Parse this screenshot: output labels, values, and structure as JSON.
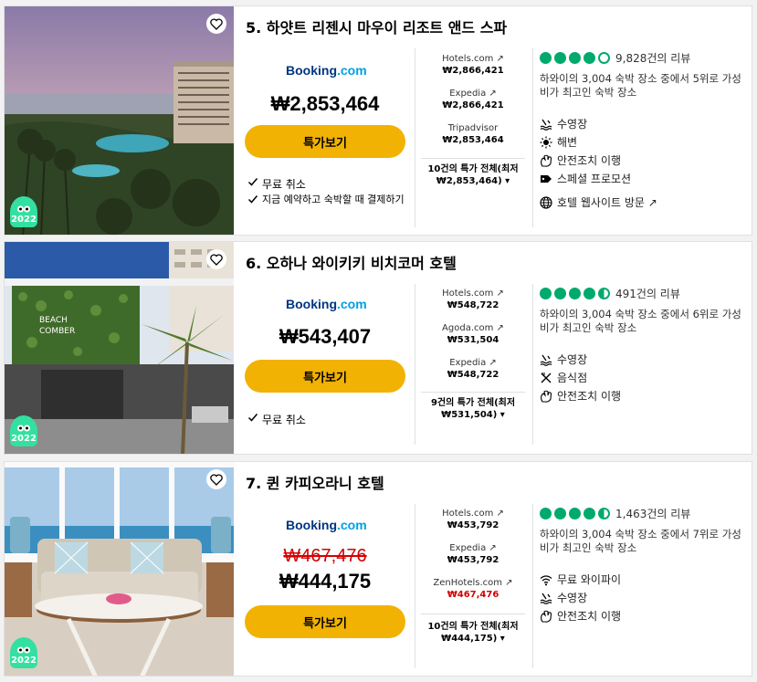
{
  "hotels": [
    {
      "title": "5. 하얏트 리젠시 마우이 리조트 앤드 스파",
      "badge_year": "2022",
      "booking_logo": "Booking",
      "booking_logo_suffix": ".com",
      "price": "₩2,853,464",
      "deal_button": "특가보기",
      "perks": [
        "무료 취소",
        "지금 예약하고 숙박할 때 결제하기"
      ],
      "providers": [
        {
          "name": "Hotels.com ↗",
          "price": "₩2,866,421"
        },
        {
          "name": "Expedia ↗",
          "price": "₩2,866,421"
        },
        {
          "name": "Tripadvisor",
          "price": "₩2,853,464"
        }
      ],
      "all_deals_line1": "10건의 특가 전체(최저",
      "all_deals_line2": "₩2,853,464) ▾",
      "rating": 4,
      "reviews": "9,828건의 리뷰",
      "rank": "하와이의 3,004 숙박 장소 중에서 5위로 가성비가 최고인 숙박 장소",
      "amenities": [
        {
          "icon": "pool-icon",
          "label": "수영장"
        },
        {
          "icon": "beach-icon",
          "label": "해변"
        },
        {
          "icon": "safety-icon",
          "label": "안전조치 이행"
        },
        {
          "icon": "tag-icon",
          "label": "스페셜 프로모션"
        },
        {
          "icon": "globe-icon",
          "label": "호텔 웹사이트 방문 ↗"
        }
      ]
    },
    {
      "title": "6. 오하나 와이키키 비치코머 호텔",
      "badge_year": "2022",
      "booking_logo": "Booking",
      "booking_logo_suffix": ".com",
      "price": "₩543,407",
      "deal_button": "특가보기",
      "perks": [
        "무료 취소"
      ],
      "providers": [
        {
          "name": "Hotels.com ↗",
          "price": "₩548,722"
        },
        {
          "name": "Agoda.com ↗",
          "price": "₩531,504"
        },
        {
          "name": "Expedia ↗",
          "price": "₩548,722"
        }
      ],
      "all_deals_line1": "9건의 특가 전체(최저",
      "all_deals_line2": "₩531,504) ▾",
      "rating": 4.5,
      "reviews": "491건의 리뷰",
      "rank": "하와이의 3,004 숙박 장소 중에서 6위로 가성비가 최고인 숙박 장소",
      "amenities": [
        {
          "icon": "pool-icon",
          "label": "수영장"
        },
        {
          "icon": "restaurant-icon",
          "label": "음식점"
        },
        {
          "icon": "safety-icon",
          "label": "안전조치 이행"
        }
      ],
      "photo_sign": "BEACH COMBER"
    },
    {
      "title": "7. 퀸 카피오라니 호텔",
      "badge_year": "2022",
      "booking_logo": "Booking",
      "booking_logo_suffix": ".com",
      "price_old": "₩467,476",
      "price": "₩444,175",
      "deal_button": "특가보기",
      "perks": [],
      "providers": [
        {
          "name": "Hotels.com ↗",
          "price": "₩453,792"
        },
        {
          "name": "Expedia ↗",
          "price": "₩453,792"
        },
        {
          "name": "ZenHotels.com ↗",
          "price": "₩467,476",
          "red": true
        }
      ],
      "all_deals_line1": "10건의 특가 전체(최저",
      "all_deals_line2": "₩444,175) ▾",
      "rating": 4.5,
      "reviews": "1,463건의 리뷰",
      "rank": "하와이의 3,004 숙박 장소 중에서 7위로 가성비가 최고인 숙박 장소",
      "amenities": [
        {
          "icon": "wifi-icon",
          "label": "무료 와이파이"
        },
        {
          "icon": "pool-icon",
          "label": "수영장"
        },
        {
          "icon": "safety-icon",
          "label": "안전조치 이행"
        }
      ]
    }
  ],
  "colors": {
    "accent": "#f2b203",
    "bubble": "#00aa6c",
    "badge": "#34e0a1",
    "strike": "#d30000",
    "booking": "#003580"
  }
}
